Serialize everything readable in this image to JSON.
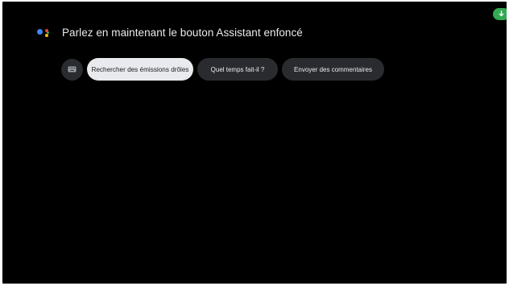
{
  "assistant": {
    "prompt": "Parlez en maintenant le bouton Assistant enfoncé",
    "logo_icon": "google-assistant-icon"
  },
  "suggestions": {
    "keyboard_icon": "keyboard-icon",
    "chips": [
      {
        "label": "Rechercher des émissions drôles",
        "selected": true
      },
      {
        "label": "Quel temps fait-il ?",
        "selected": false
      },
      {
        "label": "Envoyer des commentaires",
        "selected": false
      }
    ]
  },
  "status": {
    "badge_icon": "download-arrow-icon"
  },
  "colors": {
    "background": "#000000",
    "chip_background": "#2a2b2e",
    "chip_selected_background": "#e8eaed",
    "text_primary": "#e8eaed",
    "badge_green": "#34a853",
    "logo_blue": "#4285f4",
    "logo_red": "#ea4335",
    "logo_yellow": "#fbbc05",
    "logo_green": "#34a853"
  }
}
